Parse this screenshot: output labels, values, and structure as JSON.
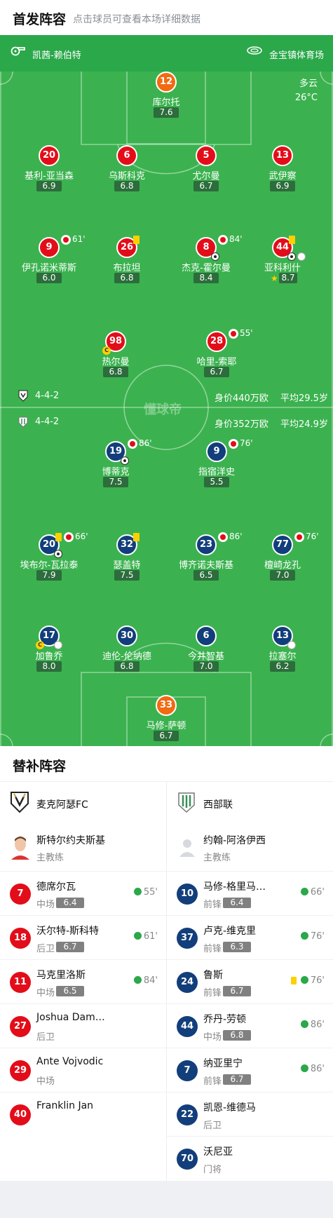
{
  "header": {
    "title": "首发阵容",
    "subtitle": "点击球员可查看本场详细数据"
  },
  "match": {
    "referee": "凯茜-赖伯特",
    "stadium": "金宝镇体育场",
    "weather": "多云",
    "temperature": "26°C"
  },
  "home": {
    "formation": "4-4-2",
    "value": "身价440万欧",
    "age": "平均29.5岁",
    "players": [
      {
        "num": "12",
        "name": "库尔托",
        "rating": "7.6",
        "color": "orange"
      },
      {
        "num": "20",
        "name": "基利-亚当森",
        "rating": "6.9",
        "color": "red"
      },
      {
        "num": "6",
        "name": "乌斯科克",
        "rating": "6.8",
        "color": "red"
      },
      {
        "num": "5",
        "name": "尤尔曼",
        "rating": "6.7",
        "color": "red"
      },
      {
        "num": "13",
        "name": "武伊察",
        "rating": "6.9",
        "color": "red"
      },
      {
        "num": "9",
        "name": "伊孔诺米蒂斯",
        "rating": "6.0",
        "color": "red",
        "sub": "61'"
      },
      {
        "num": "26",
        "name": "布拉坦",
        "rating": "6.8",
        "color": "red"
      },
      {
        "num": "8",
        "name": "杰克-霍尔曼",
        "rating": "8.4",
        "color": "red",
        "sub": "84'"
      },
      {
        "num": "44",
        "name": "亚科利什",
        "rating": "8.7",
        "color": "red"
      },
      {
        "num": "98",
        "name": "热尔曼",
        "rating": "6.8",
        "color": "red"
      },
      {
        "num": "28",
        "name": "哈里-索耶",
        "rating": "6.7",
        "color": "red",
        "sub": "55'"
      }
    ]
  },
  "away": {
    "formation": "4-4-2",
    "value": "身价352万欧",
    "age": "平均24.9岁",
    "players": [
      {
        "num": "19",
        "name": "博蒂克",
        "rating": "7.5",
        "color": "blue",
        "sub": "86'"
      },
      {
        "num": "9",
        "name": "指宿洋史",
        "rating": "5.5",
        "color": "blue",
        "sub": "76'"
      },
      {
        "num": "20",
        "name": "埃布尔-瓦拉泰",
        "rating": "7.9",
        "color": "blue",
        "sub": "66'"
      },
      {
        "num": "32",
        "name": "瑟盖特",
        "rating": "7.5",
        "color": "blue"
      },
      {
        "num": "23",
        "name": "博齐诺夫斯基",
        "rating": "6.5",
        "color": "blue",
        "sub": "86'"
      },
      {
        "num": "77",
        "name": "檀崎龙孔",
        "rating": "7.0",
        "color": "blue",
        "sub": "76'"
      },
      {
        "num": "17",
        "name": "加鲁乔",
        "rating": "8.0",
        "color": "blue"
      },
      {
        "num": "30",
        "name": "迪伦-伦纳德",
        "rating": "6.8",
        "color": "blue"
      },
      {
        "num": "6",
        "name": "今井智基",
        "rating": "7.0",
        "color": "blue"
      },
      {
        "num": "13",
        "name": "拉塞尔",
        "rating": "6.2",
        "color": "blue"
      },
      {
        "num": "33",
        "name": "马修-萨顿",
        "rating": "6.7",
        "color": "orange"
      }
    ]
  },
  "watermark": "懂球帝",
  "subs": {
    "title": "替补阵容",
    "home": {
      "team": "麦克阿瑟FC",
      "coach": "斯特尔约夫斯基",
      "coach_role": "主教练",
      "players": [
        {
          "num": "7",
          "name": "德席尔瓦",
          "pos": "中场",
          "rating": "6.4",
          "in": "55'"
        },
        {
          "num": "18",
          "name": "沃尔特-斯科特",
          "pos": "后卫",
          "rating": "6.7",
          "in": "61'"
        },
        {
          "num": "11",
          "name": "马克里洛斯",
          "pos": "中场",
          "rating": "6.5",
          "in": "84'"
        },
        {
          "num": "27",
          "name": "Joshua Dam…",
          "pos": "后卫",
          "rating": "",
          "in": ""
        },
        {
          "num": "29",
          "name": "Ante Vojvodic",
          "pos": "中场",
          "rating": "",
          "in": ""
        },
        {
          "num": "40",
          "name": "Franklin Jan",
          "pos": "",
          "rating": "",
          "in": ""
        }
      ]
    },
    "away": {
      "team": "西部联",
      "coach": "约翰-阿洛伊西",
      "coach_role": "主教练",
      "players": [
        {
          "num": "10",
          "name": "马修-格里马…",
          "pos": "前锋",
          "rating": "6.4",
          "in": "66'"
        },
        {
          "num": "37",
          "name": "卢克-维克里",
          "pos": "前锋",
          "rating": "6.3",
          "in": "76'"
        },
        {
          "num": "24",
          "name": "鲁斯",
          "pos": "前锋",
          "rating": "6.7",
          "in": "76'"
        },
        {
          "num": "44",
          "name": "乔丹-劳顿",
          "pos": "中场",
          "rating": "6.8",
          "in": "86'"
        },
        {
          "num": "7",
          "name": "纳亚里宁",
          "pos": "前锋",
          "rating": "6.7",
          "in": "86'"
        },
        {
          "num": "22",
          "name": "凯恩-维德马",
          "pos": "后卫",
          "rating": "",
          "in": ""
        },
        {
          "num": "70",
          "name": "沃尼亚",
          "pos": "门将",
          "rating": "",
          "in": ""
        }
      ]
    }
  },
  "colors": {
    "pitch": "#3bb24f",
    "red": "#e30d1a",
    "blue": "#123e7b",
    "orange": "#f26a12",
    "yellow": "#ffd000"
  }
}
